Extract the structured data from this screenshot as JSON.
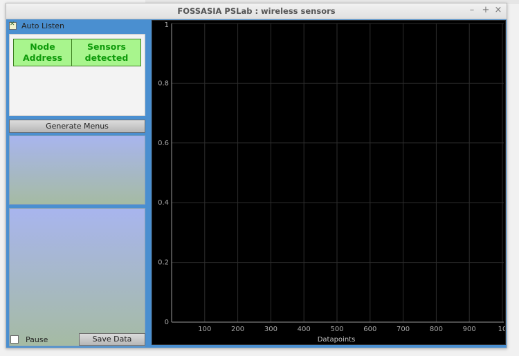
{
  "window": {
    "title": "FOSSASIA PSLab : wireless sensors",
    "controls": {
      "minimize": "–",
      "maximize": "+",
      "close": "×"
    }
  },
  "sidebar": {
    "auto_listen": {
      "label": "Auto Listen",
      "checked": true
    },
    "node_table": {
      "columns": [
        {
          "line1": "Node",
          "line2": "Address"
        },
        {
          "line1": "Sensors",
          "line2": "detected"
        }
      ],
      "header_color": "#a8f58d",
      "text_color": "#0e9a0a"
    },
    "generate_menus_button": "Generate Menus",
    "pause": {
      "label": "Pause",
      "checked": false
    },
    "save_data_button": "Save Data"
  },
  "plot": {
    "xlabel": "Datapoints",
    "background": "#000000",
    "y_ticks": [
      "0",
      "0.2",
      "0.4",
      "0.6",
      "0.8",
      "1"
    ],
    "x_ticks": [
      "100",
      "200",
      "300",
      "400",
      "500",
      "600",
      "700",
      "800",
      "900",
      "10"
    ]
  }
}
